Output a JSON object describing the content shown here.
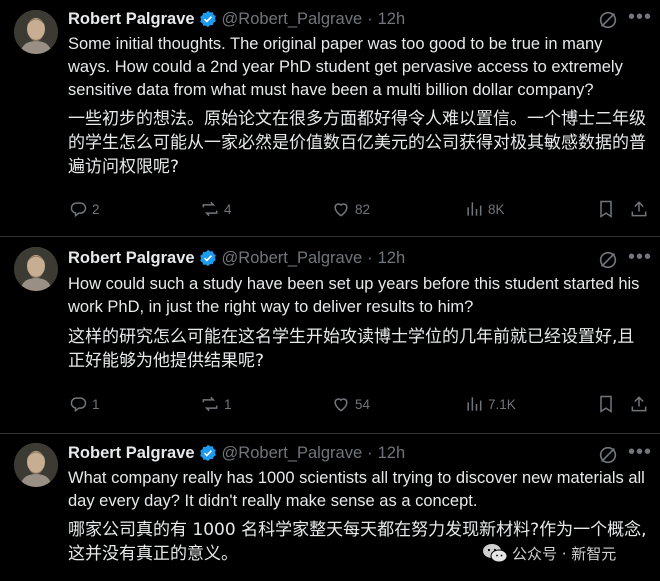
{
  "tweets": [
    {
      "name": "Robert Palgrave",
      "handle": "@Robert_Palgrave",
      "separator": "·",
      "time": "12h",
      "text_en": "Some initial thoughts. The original paper was too good to be true in many ways. How could a 2nd year PhD student get pervasive access to extremely sensitive data from what must have been a multi billion dollar company?",
      "text_zh": "一些初步的想法。原始论文在很多方面都好得令人难以置信。一个博士二年级的学生怎么可能从一家必然是价值数百亿美元的公司获得对极其敏感数据的普遍访问权限呢?",
      "replies": "2",
      "reposts": "4",
      "likes": "82",
      "views": "8K"
    },
    {
      "name": "Robert Palgrave",
      "handle": "@Robert_Palgrave",
      "separator": "·",
      "time": "12h",
      "text_en": "How could such a study have been set up years before this student started his work PhD, in just the right way to deliver results to him?",
      "text_zh": "这样的研究怎么可能在这名学生开始攻读博士学位的几年前就已经设置好,且正好能够为他提供结果呢?",
      "replies": "1",
      "reposts": "1",
      "likes": "54",
      "views": "7.1K"
    },
    {
      "name": "Robert Palgrave",
      "handle": "@Robert_Palgrave",
      "separator": "·",
      "time": "12h",
      "text_en": "What company really has 1000 scientists all trying to discover new materials all day every day? It didn't really make sense as a concept.",
      "text_zh": "哪家公司真的有 1000 名科学家整天每天都在努力发现新材料?作为一个概念,这并没有真正的意义。"
    }
  ],
  "watermark": "公众号 · 新智元",
  "colors": {
    "background": "#000000",
    "text": "#e7e9ea",
    "muted": "#71767b",
    "verified": "#1d9bf0",
    "divider": "#2f3336"
  },
  "icons": [
    "verified-badge-icon",
    "grok-icon",
    "more-icon",
    "reply-icon",
    "repost-icon",
    "like-icon",
    "views-icon",
    "bookmark-icon",
    "share-icon",
    "wechat-icon"
  ]
}
